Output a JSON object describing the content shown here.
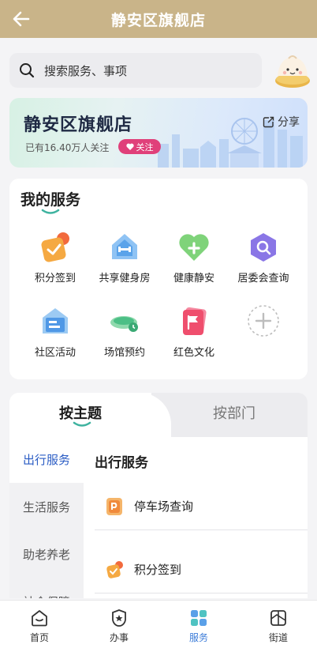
{
  "header": {
    "title": "静安区旗舰店",
    "back_icon": "arrow-left-icon"
  },
  "search": {
    "placeholder": "搜索服务、事项"
  },
  "banner": {
    "title": "静安区旗舰店",
    "followers": "已有16.40万人关注",
    "follow_label": "关注",
    "share_label": "分享"
  },
  "my_services": {
    "title": "我的服务",
    "items": [
      {
        "label": "积分签到",
        "icon": "points-checkin-icon"
      },
      {
        "label": "共享健身房",
        "icon": "gym-icon"
      },
      {
        "label": "健康静安",
        "icon": "health-heart-icon"
      },
      {
        "label": "居委会查询",
        "icon": "committee-search-icon"
      },
      {
        "label": "社区活动",
        "icon": "community-activity-icon"
      },
      {
        "label": "场馆预约",
        "icon": "venue-booking-icon"
      },
      {
        "label": "红色文化",
        "icon": "red-flag-icon"
      }
    ],
    "add_icon": "add-icon"
  },
  "topics": {
    "tabs": [
      "按主题",
      "按部门"
    ],
    "active_tab": "按主题",
    "side": [
      "出行服务",
      "生活服务",
      "助老养老",
      "社会保障"
    ],
    "content_title": "出行服务",
    "rows": [
      {
        "label": "停车场查询",
        "icon": "parking-icon"
      },
      {
        "label": "积分签到",
        "icon": "points-checkin-icon"
      }
    ]
  },
  "tabbar": {
    "items": [
      {
        "label": "首页",
        "icon": "home-icon"
      },
      {
        "label": "办事",
        "icon": "task-star-icon"
      },
      {
        "label": "服务",
        "icon": "grid-services-icon"
      },
      {
        "label": "街道",
        "icon": "street-map-icon"
      }
    ],
    "active": "服务",
    "accent": "#3c7cd8"
  },
  "colors": {
    "header": "#c9b489",
    "follow": "#e0407a",
    "active_side": "#2a5cc4"
  }
}
